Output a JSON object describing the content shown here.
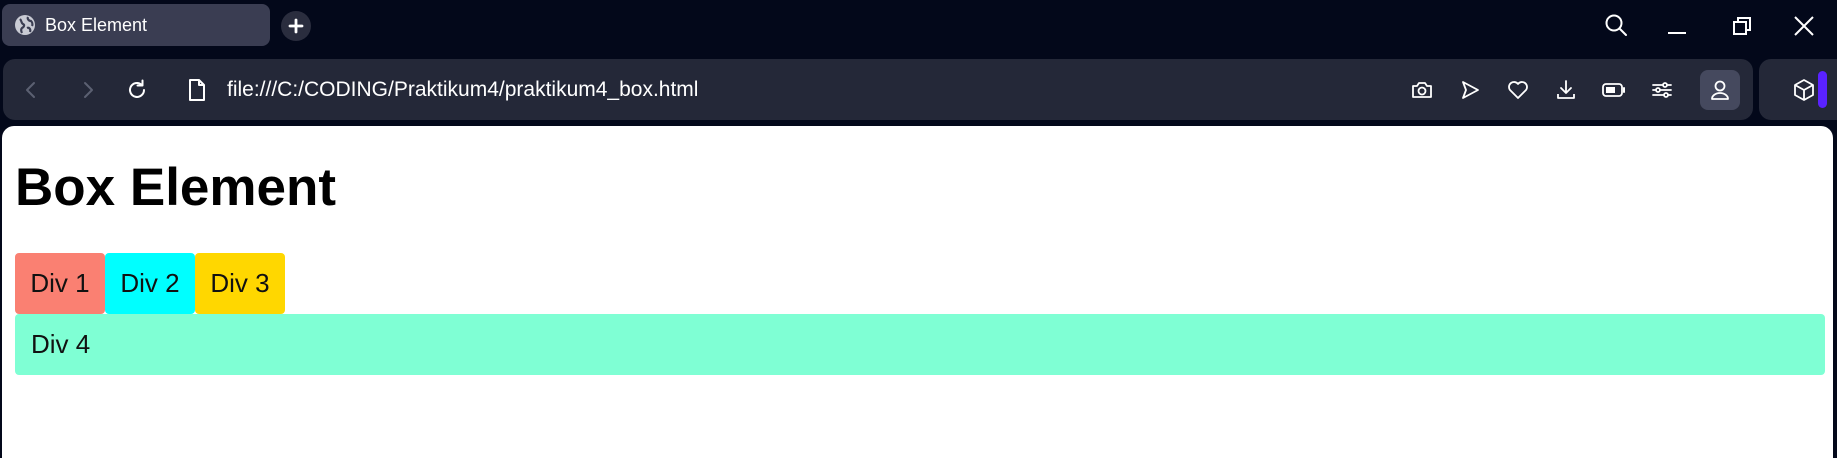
{
  "browser": {
    "tab": {
      "title": "Box Element",
      "favicon": "globe-icon"
    },
    "toolbar": {
      "url": "file:///C:/CODING/Praktikum4/praktikum4_box.html",
      "icons": [
        "back-icon",
        "forward-icon",
        "reload-icon",
        "page-icon",
        "camera-icon",
        "send-icon",
        "heart-icon",
        "download-icon",
        "battery-icon",
        "sliders-icon",
        "profile-icon",
        "extensions-cube-icon"
      ]
    },
    "window_controls": [
      "search-icon",
      "minimize-icon",
      "restore-icon",
      "close-icon"
    ]
  },
  "page": {
    "heading": "Box Element",
    "boxes": [
      {
        "label": "Div 1",
        "color": "#fa8072"
      },
      {
        "label": "Div 2",
        "color": "#00ffff"
      },
      {
        "label": "Div 3",
        "color": "#ffd700"
      },
      {
        "label": "Div 4",
        "color": "#7fffd4"
      }
    ]
  },
  "colors": {
    "chrome_bg": "#03081a",
    "toolbar_bg": "#242838",
    "active_tab": "#3a3d52",
    "accent": "#5a22ff"
  }
}
